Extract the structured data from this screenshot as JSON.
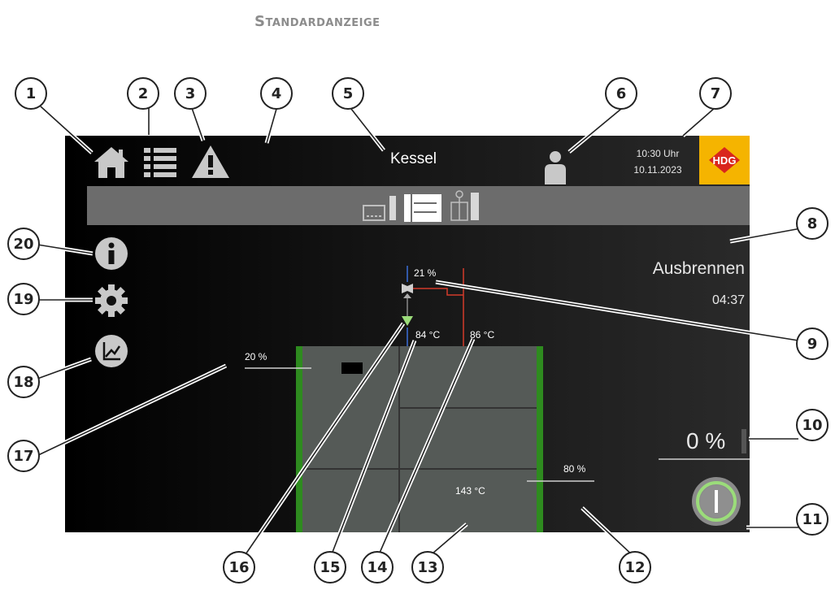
{
  "heading": "Standardanzeige",
  "screen": {
    "title": "Kessel",
    "time": "10:30 Uhr",
    "date": "10.11.2023",
    "logo_text": "HDG",
    "status": "Ausbrennen",
    "status_time": "04:37",
    "mixer_pct": "21 %",
    "flow_temp": "84 °C",
    "return_temp": "86 °C",
    "left_pct": "20 %",
    "right_pct": "80 %",
    "chamber_temp": "143 °C",
    "output_pct": "0 %",
    "output_level": 0
  },
  "callouts": [
    "1",
    "2",
    "3",
    "4",
    "5",
    "6",
    "7",
    "8",
    "9",
    "10",
    "11",
    "12",
    "13",
    "14",
    "15",
    "16",
    "17",
    "18",
    "19",
    "20"
  ],
  "icons": {
    "home": "home-icon",
    "menu": "list-icon",
    "warning": "warning-icon",
    "user": "user-icon",
    "info": "info-icon",
    "settings": "gear-icon",
    "chart": "chart-icon",
    "power": "power-icon"
  },
  "colors": {
    "accent": "#f5b400",
    "green": "#2e8b1f",
    "red": "#d23a2a",
    "blue": "#3a6fd8",
    "green_valve": "#9bdc7a"
  }
}
